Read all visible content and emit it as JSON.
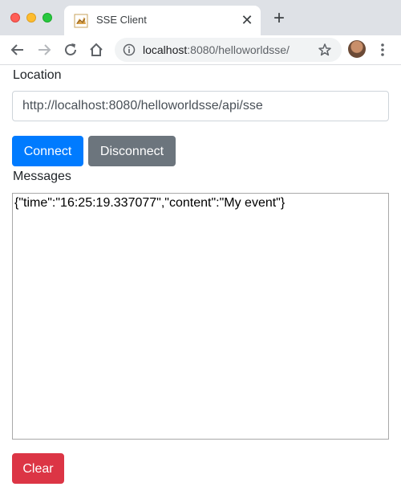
{
  "browser": {
    "tab_title": "SSE Client",
    "tab_close_glyph": "✕",
    "new_tab_glyph": "+",
    "url_host": "localhost",
    "url_rest": ":8080/helloworldsse/"
  },
  "page": {
    "location_label": "Location",
    "location_value": "http://localhost:8080/helloworldsse/api/sse",
    "connect_label": "Connect",
    "disconnect_label": "Disconnect",
    "messages_label": "Messages",
    "messages_text": "{\"time\":\"16:25:19.337077\",\"content\":\"My event\"}",
    "clear_label": "Clear"
  },
  "colors": {
    "primary": "#007bff",
    "secondary": "#6c757d",
    "danger": "#dc3545"
  },
  "icons": [
    "back-arrow-icon",
    "forward-arrow-icon",
    "reload-icon",
    "home-icon",
    "info-icon",
    "star-icon",
    "menu-dots-icon",
    "tab-favicon-icon"
  ]
}
